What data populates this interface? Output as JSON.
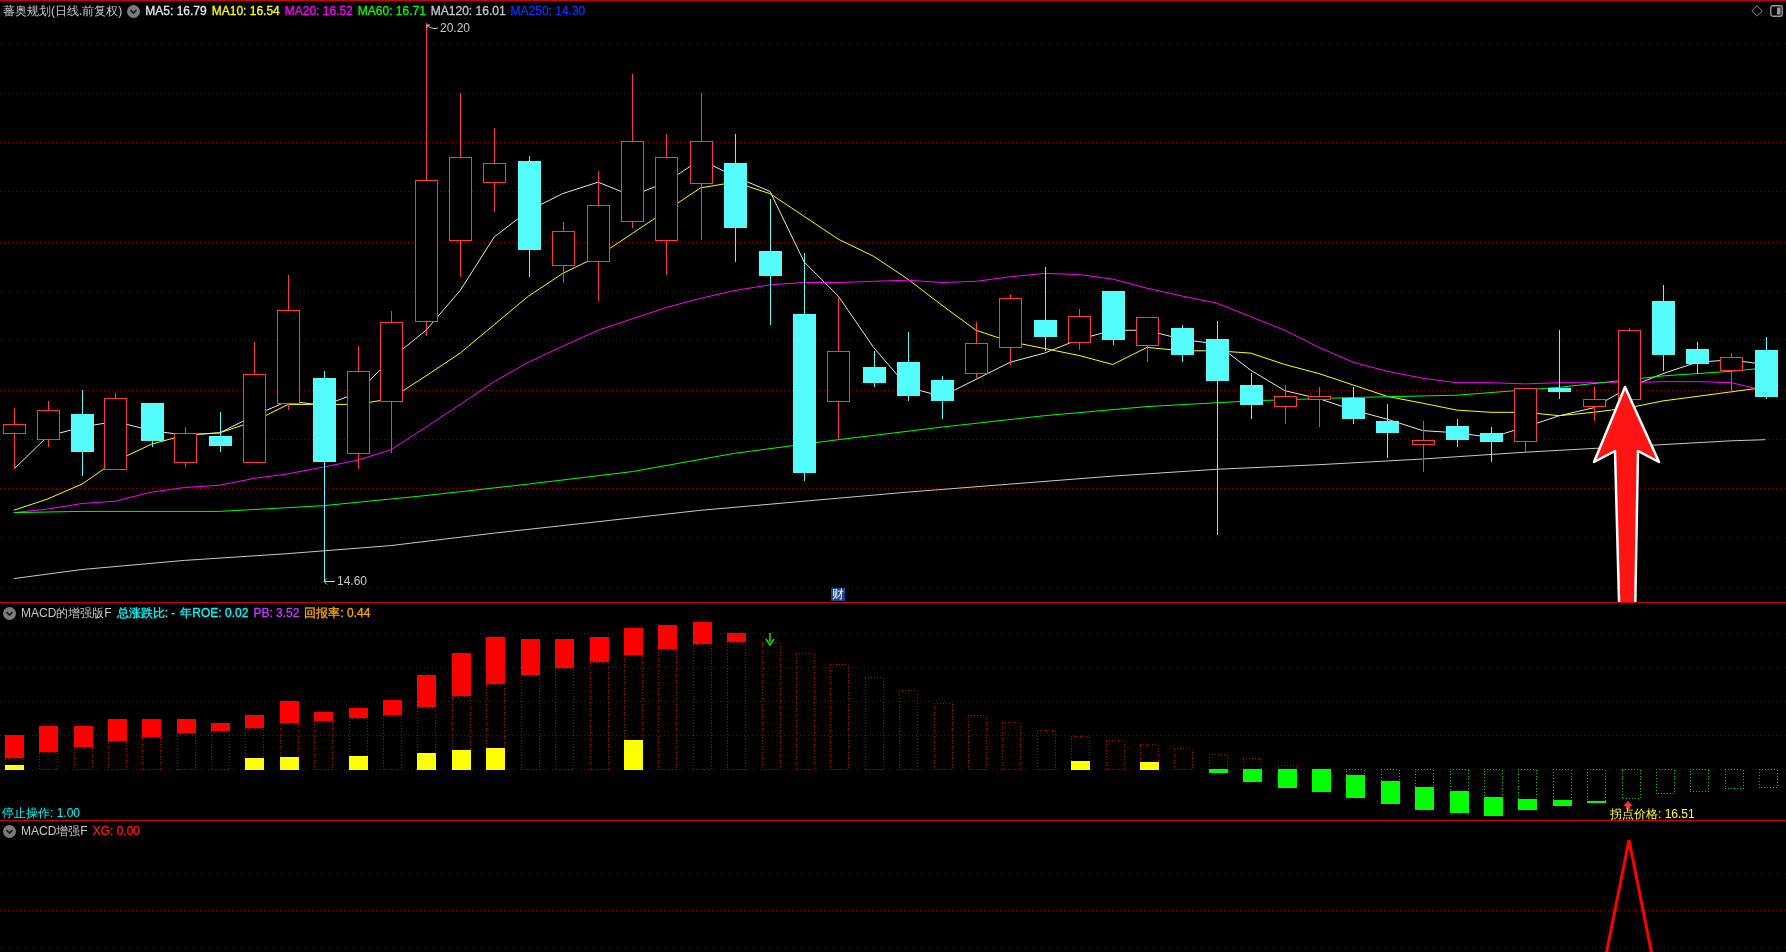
{
  "main_chart": {
    "title": "蕃奥规划(日线.前复权)",
    "moving_averages": [
      {
        "label": "MA5: 16.79",
        "color": "#e6e6e6"
      },
      {
        "label": "MA10: 16.54",
        "color": "#ffff00"
      },
      {
        "label": "MA20: 16.52",
        "color": "#ff00ff"
      },
      {
        "label": "MA60: 16.71",
        "color": "#00ff00"
      },
      {
        "label": "MA120: 16.01",
        "color": "#c8c8c8"
      },
      {
        "label": "MA250: 14.30",
        "color": "#1030ff"
      }
    ],
    "high_marker": "20.20",
    "low_marker": "14.60",
    "badge": "财"
  },
  "macd_panel": {
    "title": "MACD的增强版F",
    "readings": [
      {
        "label": "总涨跌比: -",
        "color": "#00ffff"
      },
      {
        "label": "年ROE: 0.02",
        "color": "#00ffff"
      },
      {
        "label": "PB: 3.52",
        "color": "#c040ff"
      },
      {
        "label": "回报率: 0.44",
        "color": "#ffa800"
      }
    ],
    "stop_label": "停止操作: 1.00",
    "pivot_label": "拐点价格: 16.51"
  },
  "xg_panel": {
    "title": "MACD增强F",
    "readings": [
      {
        "label": "XG: 0.00",
        "color": "#ff1a1a"
      }
    ]
  }
}
